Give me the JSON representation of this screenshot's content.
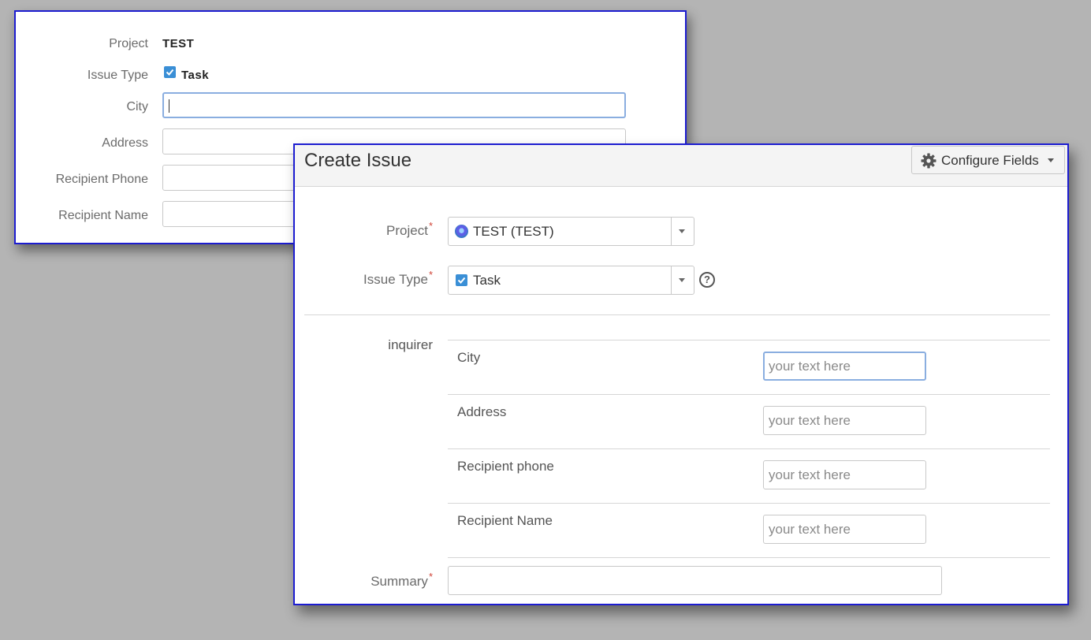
{
  "back_form": {
    "project_label": "Project",
    "project_value": "TEST",
    "issue_type_label": "Issue Type",
    "issue_type_value": "Task",
    "city_label": "City",
    "address_label": "Address",
    "recipient_phone_label": "Recipient Phone",
    "recipient_name_label": "Recipient Name"
  },
  "dialog": {
    "title": "Create Issue",
    "configure_fields_label": "Configure Fields",
    "project_label": "Project",
    "project_value": "TEST (TEST)",
    "issue_type_label": "Issue Type",
    "issue_type_value": "Task",
    "required_mark": "*",
    "help_glyph": "?",
    "group_label": "inquirer",
    "rows": [
      {
        "label": "City",
        "placeholder": "your text here"
      },
      {
        "label": "Address",
        "placeholder": "your text here"
      },
      {
        "label": "Recipient phone",
        "placeholder": "your text here"
      },
      {
        "label": "Recipient Name",
        "placeholder": "your text here"
      }
    ],
    "summary_label": "Summary"
  },
  "colors": {
    "panel_border": "#1c1cd0",
    "required": "#d04437",
    "checkbox": "#3a8fd6",
    "focus_border": "#8aaee0"
  },
  "icons": [
    "checkbox-icon",
    "gear-icon",
    "chevron-down-icon",
    "project-avatar-icon",
    "help-icon"
  ]
}
